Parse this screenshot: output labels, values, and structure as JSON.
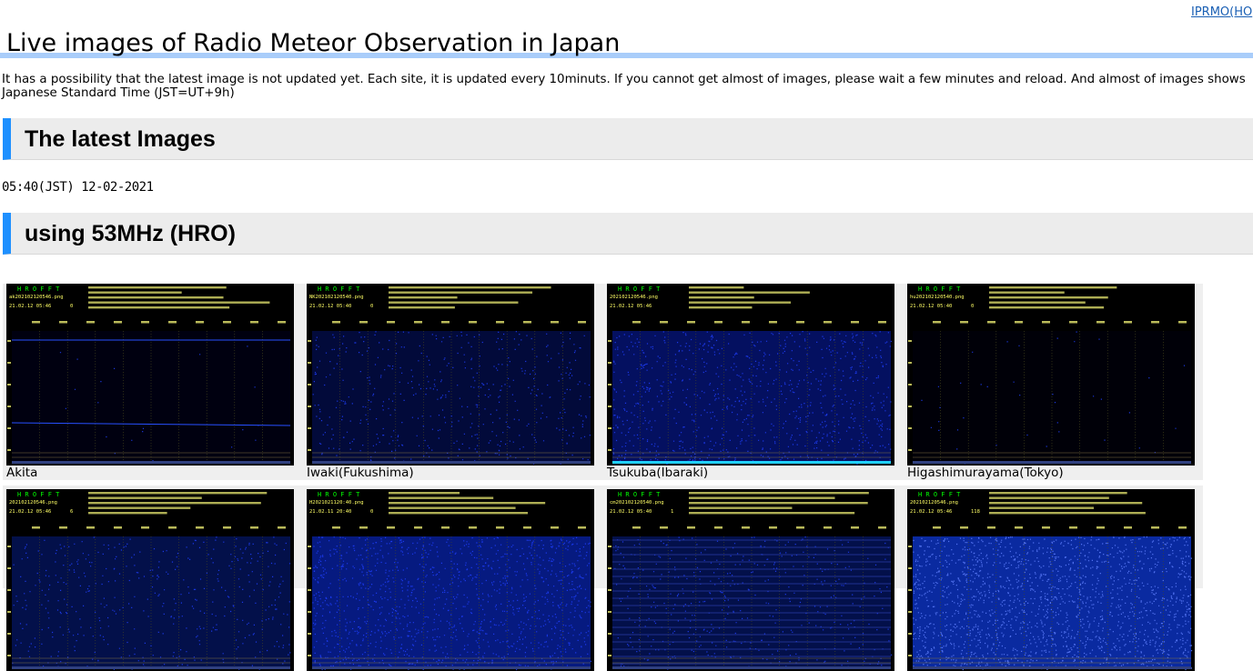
{
  "header": {
    "top_link": "IPRMO(HO",
    "title": "Live images of Radio Meteor Observation in Japan"
  },
  "intro": {
    "text": "It has a possibility that the latest image is not updated yet. Each site, it is updated every 10minuts. If you cannot get almost of images, please wait a few minutes and reload. And almost of images shows Japanese Standard Time (JST=UT+9h)"
  },
  "latest": {
    "heading": "The latest Images",
    "timestamp": "05:40(JST) 12-02-2021"
  },
  "hro53": {
    "heading": "using 53MHz (HRO)",
    "tiles": [
      {
        "caption": "Akita",
        "file": "ak202102120546.png",
        "date": "21.02.12 05:46",
        "meteor": "0",
        "logo": "H R O F F T",
        "style": "dark"
      },
      {
        "caption": "Iwaki(Fukushima)",
        "file": "NK202102120540.png",
        "date": "21.02.12 05:40",
        "meteor": "0",
        "logo": "H R O F F T",
        "style": "sparse"
      },
      {
        "caption": "Tsukuba(Ibaraki)",
        "file": "202102120546.png",
        "date": "21.02.12 05:46",
        "meteor": "",
        "logo": "H R O F F T",
        "style": "medium"
      },
      {
        "caption": "Higashimurayama(Tokyo)",
        "file": "hu202102120540.png",
        "date": "21.02.12 05:40",
        "meteor": "0",
        "logo": "H R O F F T",
        "style": "dark2"
      },
      {
        "caption": "",
        "file": "202102120546.png",
        "date": "21.02.12 05:46",
        "meteor": "6",
        "logo": "H R O F F T",
        "style": "sparse2"
      },
      {
        "caption": "",
        "file": "H2021021120:40.png",
        "date": "21.02.11 20:40",
        "meteor": "0",
        "logo": "H R O F F T",
        "style": "dense"
      },
      {
        "caption": "",
        "file": "cm202102120540.png",
        "date": "21.02.12 05:40",
        "meteor": "1",
        "logo": "H R O F F T",
        "style": "lines"
      },
      {
        "caption": "",
        "file": "202102120546.png",
        "date": "21.02.12 05:46",
        "meteor": "118",
        "logo": "H R O F F T",
        "style": "bright"
      }
    ]
  },
  "colors": {
    "accent_blue": "#1e90ff",
    "title_underline": "#a9cdfa",
    "section_bg": "#ececec",
    "link": "#1a5fb4",
    "spectrogram_logo": "#00ff00",
    "spectrogram_text": "#ffff66"
  }
}
